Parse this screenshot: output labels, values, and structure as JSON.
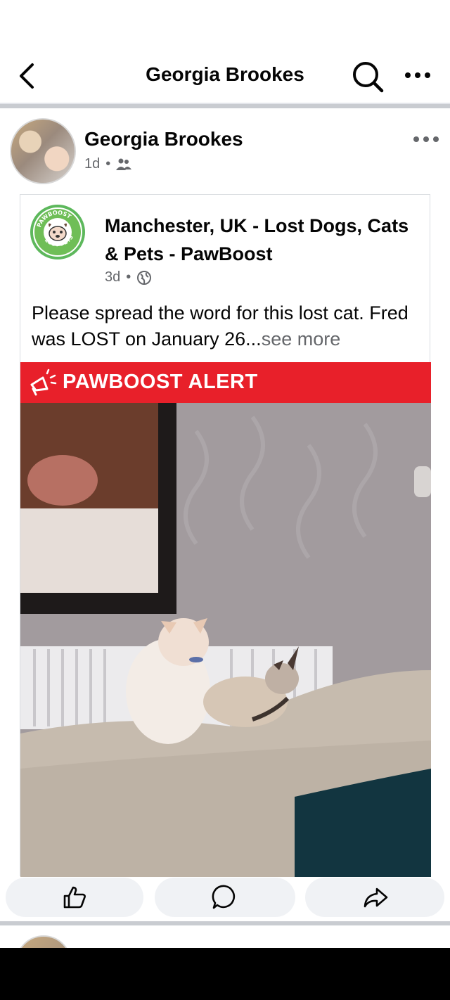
{
  "topbar": {
    "title": "Georgia Brookes",
    "back_icon": "chevron-left-icon",
    "search_icon": "search-icon",
    "more_icon": "more-horizontal-icon"
  },
  "post": {
    "author": "Georgia Brookes",
    "time": "1d",
    "audience_icon": "friends-icon",
    "shared": {
      "page_name": "Manchester, UK - Lost Dogs, Cats & Pets - PawBoost",
      "avatar_text_top": "PAWBOOST",
      "avatar_text_bottom": "LOST PETS",
      "time": "3d",
      "audience_icon": "globe-icon",
      "text": "Please spread the word for this lost cat. Fred was LOST on January 26...",
      "see_more": "see more",
      "alert": "PAWBOOST ALERT",
      "alert_icon": "megaphone-icon",
      "alert_color": "#e8202a"
    }
  },
  "actions": {
    "like_icon": "thumbs-up-icon",
    "comment_icon": "comment-icon",
    "share_icon": "share-icon"
  }
}
